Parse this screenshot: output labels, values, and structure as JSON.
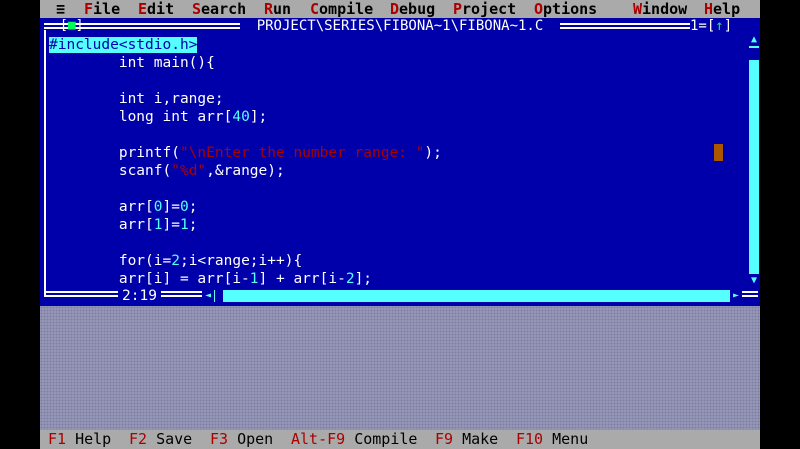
{
  "menu": {
    "system": "≡",
    "items": [
      {
        "hot": "F",
        "rest": "ile"
      },
      {
        "hot": "E",
        "rest": "dit"
      },
      {
        "hot": "S",
        "rest": "earch"
      },
      {
        "hot": "R",
        "rest": "un"
      },
      {
        "hot": "C",
        "rest": "ompile"
      },
      {
        "hot": "D",
        "rest": "ebug"
      },
      {
        "hot": "P",
        "rest": "roject"
      },
      {
        "hot": "O",
        "rest": "ptions"
      },
      {
        "hot": "W",
        "rest": "indow"
      },
      {
        "hot": "H",
        "rest": "elp"
      }
    ]
  },
  "editor": {
    "close_box_left": "[",
    "close_box_mark": "■",
    "close_box_right": "]",
    "title": "PROJECT\\SERIES\\FIBONA~1\\FIBONA~1.C",
    "window_number": "1=[",
    "zoom_arrow": "↑",
    "window_number_end": "]",
    "cursor_pos": "2:19",
    "scroll_up": "▲",
    "scroll_down": "▼",
    "scroll_left": "◄",
    "scroll_right": "►",
    "code_lines": [
      {
        "indent": "",
        "parts": [
          {
            "t": "#include<stdio.h>",
            "c": "sel"
          }
        ]
      },
      {
        "indent": "        ",
        "parts": [
          {
            "t": "int main(){",
            "c": ""
          }
        ]
      },
      {
        "indent": "",
        "parts": []
      },
      {
        "indent": "        ",
        "parts": [
          {
            "t": "int i,range;",
            "c": ""
          }
        ]
      },
      {
        "indent": "        ",
        "parts": [
          {
            "t": "long int arr[",
            "c": ""
          },
          {
            "t": "40",
            "c": "num"
          },
          {
            "t": "];",
            "c": ""
          }
        ]
      },
      {
        "indent": "",
        "parts": []
      },
      {
        "indent": "        ",
        "parts": [
          {
            "t": "printf(",
            "c": ""
          },
          {
            "t": "\"\\nEnter the number range: \"",
            "c": "str"
          },
          {
            "t": ");",
            "c": ""
          }
        ]
      },
      {
        "indent": "        ",
        "parts": [
          {
            "t": "scanf(",
            "c": ""
          },
          {
            "t": "\"%d\"",
            "c": "str"
          },
          {
            "t": ",&range);",
            "c": ""
          }
        ]
      },
      {
        "indent": "",
        "parts": []
      },
      {
        "indent": "        ",
        "parts": [
          {
            "t": "arr[",
            "c": ""
          },
          {
            "t": "0",
            "c": "num"
          },
          {
            "t": "]=",
            "c": ""
          },
          {
            "t": "0",
            "c": "num"
          },
          {
            "t": ";",
            "c": ""
          }
        ]
      },
      {
        "indent": "        ",
        "parts": [
          {
            "t": "arr[",
            "c": ""
          },
          {
            "t": "1",
            "c": "num"
          },
          {
            "t": "]=",
            "c": ""
          },
          {
            "t": "1",
            "c": "num"
          },
          {
            "t": ";",
            "c": ""
          }
        ]
      },
      {
        "indent": "",
        "parts": []
      },
      {
        "indent": "        ",
        "parts": [
          {
            "t": "for(i=",
            "c": ""
          },
          {
            "t": "2",
            "c": "num"
          },
          {
            "t": ";i<range;i++){",
            "c": ""
          }
        ]
      },
      {
        "indent": "        ",
        "parts": [
          {
            "t": "arr[i] = arr[i-",
            "c": ""
          },
          {
            "t": "1",
            "c": "num"
          },
          {
            "t": "] + arr[i-",
            "c": ""
          },
          {
            "t": "2",
            "c": "num"
          },
          {
            "t": "];",
            "c": ""
          }
        ]
      }
    ]
  },
  "status": {
    "entries": [
      {
        "key": "F1",
        "label": " Help"
      },
      {
        "key": "F2",
        "label": " Save"
      },
      {
        "key": "F3",
        "label": " Open"
      },
      {
        "key": "Alt-F9",
        "label": " Compile"
      },
      {
        "key": "F9",
        "label": " Make"
      },
      {
        "key": "F10",
        "label": " Menu"
      }
    ]
  },
  "colors": {
    "editor_bg": "#0000aa",
    "menu_bg": "#aaaaaa",
    "hotkey": "#aa0000",
    "selection": "#55ffff",
    "string": "#aa0000"
  }
}
